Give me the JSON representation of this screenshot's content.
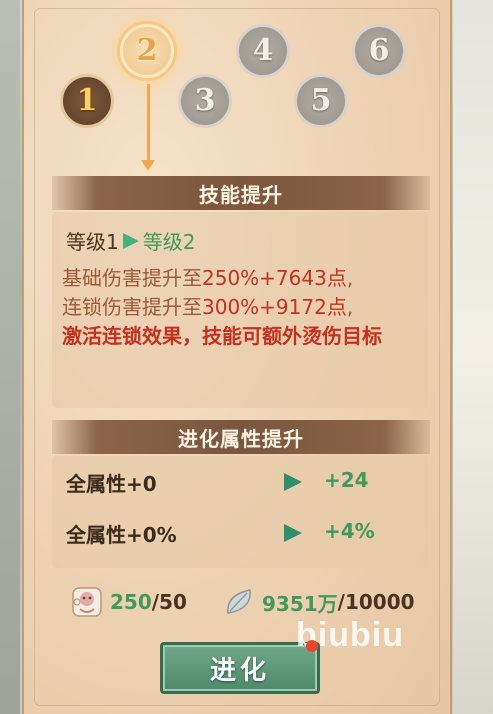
{
  "nodes": [
    {
      "id": "node-1",
      "label": "1",
      "state": "done"
    },
    {
      "id": "node-2",
      "label": "2",
      "state": "current"
    },
    {
      "id": "node-3",
      "label": "3",
      "state": "locked"
    },
    {
      "id": "node-4",
      "label": "4",
      "state": "locked"
    },
    {
      "id": "node-5",
      "label": "5",
      "state": "locked"
    },
    {
      "id": "node-6",
      "label": "6",
      "state": "locked"
    }
  ],
  "skill": {
    "title": "技能提升",
    "level_from": "等级1",
    "level_to": "等级2",
    "line1_prefix": "基础伤害提升至",
    "line1_value": "250%+7643点",
    "line1_suffix": ",",
    "line2_prefix": "连锁伤害提升至",
    "line2_value": "300%+9172点",
    "line2_suffix": ",",
    "line3": "激活连锁效果，技能可额外烫伤目标"
  },
  "evolution": {
    "title": "进化属性提升",
    "rows": [
      {
        "label": "全属性+0",
        "value": "+24"
      },
      {
        "label": "全属性+0%",
        "value": "+4%"
      }
    ]
  },
  "costs": [
    {
      "icon": "puzzle-piece-icon",
      "have": "250",
      "need": "/50"
    },
    {
      "icon": "silver-leaf-icon",
      "have": "9351万",
      "need": "/10000"
    }
  ],
  "button": {
    "label": "进化"
  },
  "watermark": "biubiu",
  "colors": {
    "accent_orange": "#f0a84f",
    "green_value": "#3f9a5b",
    "red_highlight": "#c6301f",
    "button_green": "#4f8a6b"
  }
}
